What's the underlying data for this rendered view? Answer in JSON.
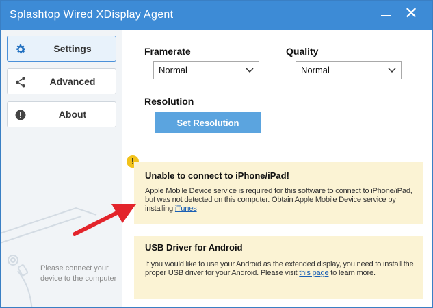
{
  "window": {
    "title": "Splashtop Wired XDisplay Agent",
    "accent_color": "#3d8bd6"
  },
  "sidebar": {
    "items": [
      {
        "label": "Settings",
        "icon": "gear-icon",
        "active": true
      },
      {
        "label": "Advanced",
        "icon": "share-icon",
        "active": false
      },
      {
        "label": "About",
        "icon": "info-icon",
        "active": false
      }
    ],
    "hint": "Please connect your device to the computer"
  },
  "settings": {
    "framerate_label": "Framerate",
    "framerate_value": "Normal",
    "quality_label": "Quality",
    "quality_value": "Normal",
    "resolution_label": "Resolution",
    "set_resolution_label": "Set Resolution"
  },
  "ios_notice": {
    "title": "Unable to connect to iPhone/iPad!",
    "body": "Apple Mobile Device service is required for this software to connect to iPhone/iPad, but was not detected on this computer. Obtain Apple Mobile Device service by installing",
    "link": "iTunes"
  },
  "android_notice": {
    "title": "USB Driver for Android",
    "body_before": "If you would like to use your Android as the extended display, you need to install the proper USB driver for your Android. Please visit",
    "link": "this page",
    "body_after": "to learn more."
  }
}
